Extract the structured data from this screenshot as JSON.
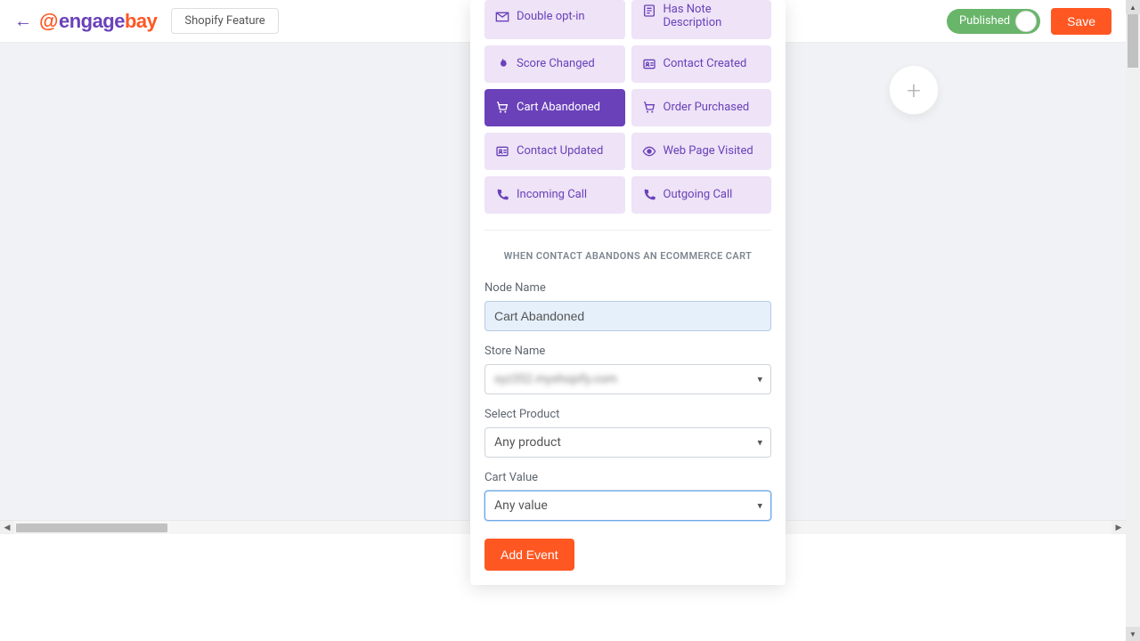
{
  "header": {
    "feature_name": "Shopify Feature",
    "published_label": "Published",
    "save_label": "Save"
  },
  "fab": {
    "plus": "+"
  },
  "panel": {
    "triggers": {
      "double_opt_in": "Double opt-in",
      "has_note_line1": "Has Note",
      "has_note_line2": "Description",
      "score_changed": "Score Changed",
      "contact_created": "Contact Created",
      "cart_abandoned": "Cart Abandoned",
      "order_purchased": "Order Purchased",
      "contact_updated": "Contact Updated",
      "web_page_visited": "Web Page Visited",
      "incoming_call": "Incoming Call",
      "outgoing_call": "Outgoing Call"
    },
    "section_title": "WHEN CONTACT ABANDONS AN ECOMMERCE CART",
    "form": {
      "node_name_label": "Node Name",
      "node_name_value": "Cart Abandoned",
      "store_name_label": "Store Name",
      "store_name_value": "xyz352.myshopify.com",
      "select_product_label": "Select Product",
      "select_product_value": "Any product",
      "cart_value_label": "Cart Value",
      "cart_value_value": "Any value",
      "add_event_label": "Add Event"
    }
  },
  "colors": {
    "brand_purple": "#6a41b9",
    "brand_orange": "#ff5722",
    "toggle_green": "#69b56a",
    "trigger_bg": "#eee3f7"
  }
}
